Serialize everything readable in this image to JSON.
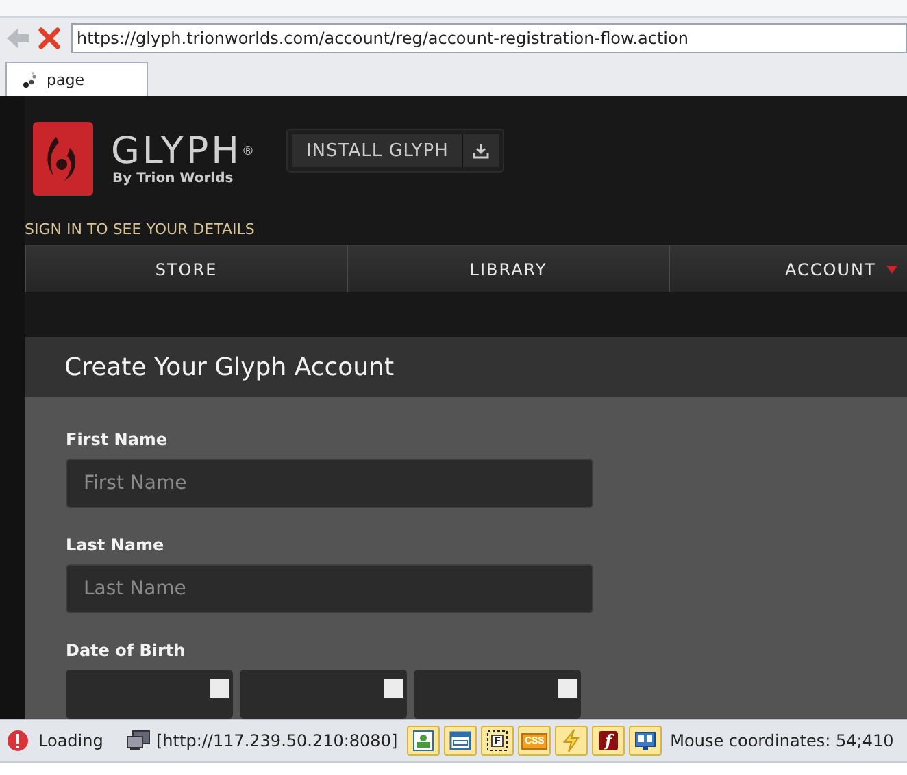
{
  "browser": {
    "url": "https://glyph.trionworlds.com/account/reg/account-registration-flow.action",
    "tabs": [
      {
        "label": "page",
        "selected": true
      }
    ]
  },
  "header": {
    "brand": "GLYPH",
    "brand_mark": "®",
    "byline": "By Trion Worlds",
    "install_button": "INSTALL GLYPH",
    "sign_in_prompt": "SIGN IN TO SEE YOUR DETAILS"
  },
  "nav": [
    {
      "label": "STORE",
      "dropdown": false
    },
    {
      "label": "LIBRARY",
      "dropdown": false
    },
    {
      "label": "ACCOUNT",
      "dropdown": true
    }
  ],
  "form": {
    "title": "Create Your Glyph Account",
    "fields": [
      {
        "kind": "text",
        "label": "First Name",
        "placeholder": "First Name"
      },
      {
        "kind": "text",
        "label": "Last Name",
        "placeholder": "Last Name"
      },
      {
        "kind": "date",
        "label": "Date of Birth",
        "parts": [
          {
            "kind": "select"
          },
          {
            "kind": "select"
          },
          {
            "kind": "select"
          }
        ]
      }
    ]
  },
  "status_bar": {
    "status": "Loading",
    "connection": "[http://117.239.50.210:8080]",
    "tools": [
      {
        "kind": "image"
      },
      {
        "kind": "window"
      },
      {
        "kind": "frame",
        "label": "F"
      },
      {
        "kind": "css",
        "label": "CSS"
      },
      {
        "kind": "bolt"
      },
      {
        "kind": "flash",
        "label": "f"
      },
      {
        "kind": "monitor"
      }
    ],
    "mouse": "Mouse coordinates: 54;410"
  }
}
